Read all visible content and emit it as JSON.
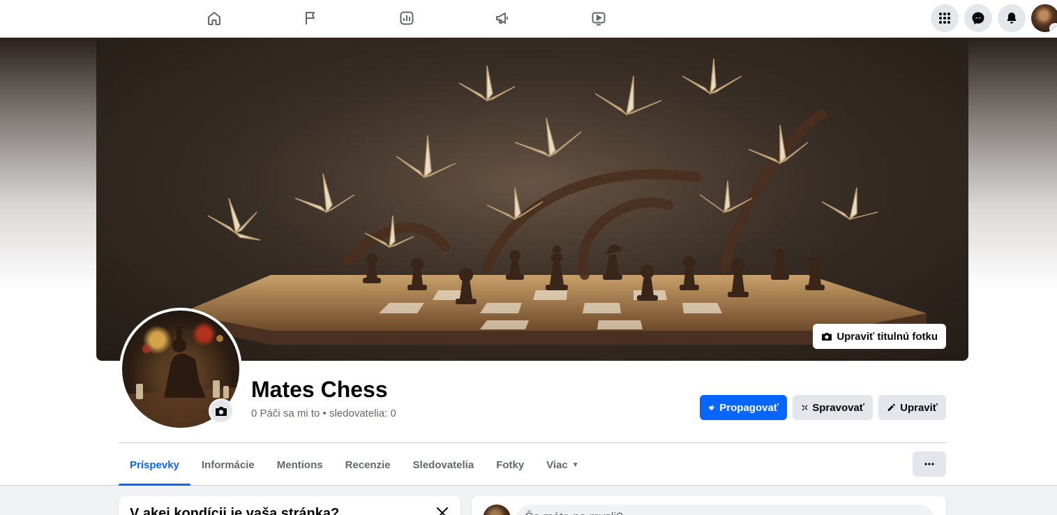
{
  "topnav": {
    "icons": [
      "home-icon",
      "flag-icon",
      "insights-icon",
      "megaphone-icon",
      "video-icon"
    ],
    "right_icons": [
      "apps-menu-icon",
      "messenger-icon",
      "bell-icon"
    ]
  },
  "cover": {
    "edit_label": "Upraviť titulnú fotku"
  },
  "page": {
    "name": "Mates Chess",
    "stats": "0 Páči sa mi to • sledovatelia: 0"
  },
  "actions": {
    "promote": "Propagovať",
    "manage": "Spravovať",
    "edit": "Upraviť"
  },
  "tabs": [
    {
      "label": "Príspevky",
      "active": true
    },
    {
      "label": "Informácie"
    },
    {
      "label": "Mentions"
    },
    {
      "label": "Recenzie"
    },
    {
      "label": "Sledovatelia"
    },
    {
      "label": "Fotky"
    },
    {
      "label": "Viac"
    }
  ],
  "health_card": {
    "title": "V akej kondícii je vaša stránka?"
  },
  "composer": {
    "placeholder": "Čo máte na mysli?"
  },
  "colors": {
    "accent": "#0866ff",
    "secondary_button": "#e4e6eb",
    "muted_text": "#65676b"
  }
}
